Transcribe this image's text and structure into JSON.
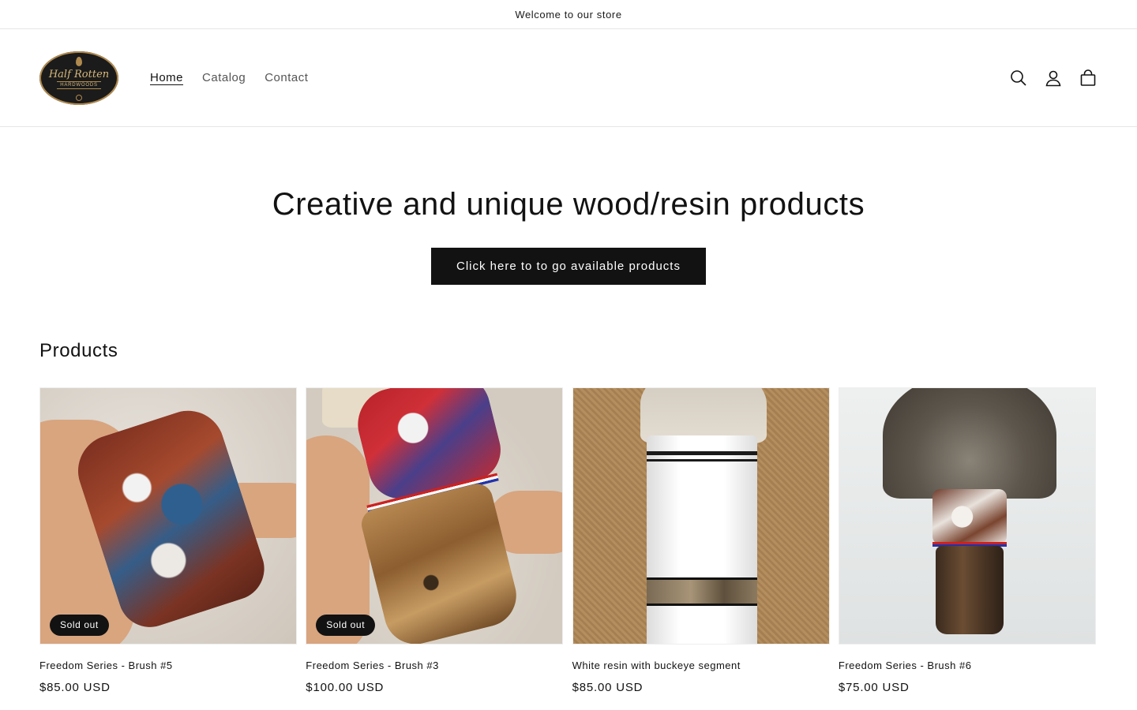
{
  "announcement": {
    "text": "Welcome to our store"
  },
  "logo": {
    "line1": "Half Rotten",
    "line2": "HARDWOODS"
  },
  "nav": {
    "items": [
      {
        "label": "Home",
        "active": true
      },
      {
        "label": "Catalog",
        "active": false
      },
      {
        "label": "Contact",
        "active": false
      }
    ]
  },
  "icons": {
    "search": "search-icon",
    "account": "account-icon",
    "cart": "cart-icon"
  },
  "hero": {
    "title": "Creative and unique wood/resin products",
    "button_label": "Click here to to go available products"
  },
  "products": {
    "heading": "Products",
    "items": [
      {
        "title": "Freedom Series - Brush #5",
        "price": "$85.00 USD",
        "badge": "Sold out"
      },
      {
        "title": "Freedom Series - Brush #3",
        "price": "$100.00 USD",
        "badge": "Sold out"
      },
      {
        "title": "White resin with buckeye segment",
        "price": "$85.00 USD",
        "badge": ""
      },
      {
        "title": "Freedom Series - Brush #6",
        "price": "$75.00 USD",
        "badge": ""
      }
    ]
  },
  "colors": {
    "primary": "#121212",
    "background": "#ffffff",
    "muted": "#555555",
    "divider": "#e6e6e6"
  }
}
